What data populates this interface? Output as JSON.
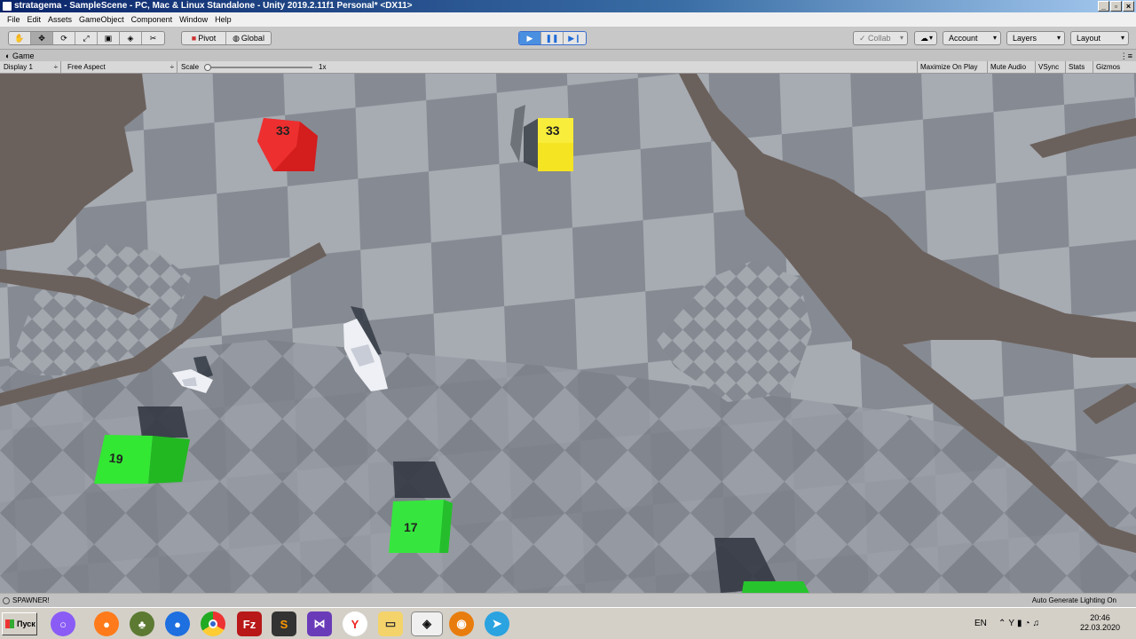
{
  "window": {
    "title": "stratagema - SampleScene - PC, Mac & Linux Standalone - Unity 2019.2.11f1 Personal* <DX11>"
  },
  "menu": [
    "File",
    "Edit",
    "Assets",
    "GameObject",
    "Component",
    "Window",
    "Help"
  ],
  "toolbar": {
    "tools": [
      "hand-tool-icon",
      "move-tool-icon",
      "rotate-tool-icon",
      "scale-tool-icon",
      "rect-tool-icon",
      "transform-tool-icon",
      "custom-tool-icon"
    ],
    "pivot": "Pivot",
    "global": "Global",
    "collab": "Collab",
    "account": "Account",
    "layers": "Layers",
    "layout": "Layout"
  },
  "game_tab": {
    "label": "Game"
  },
  "game_bar": {
    "display": "Display 1",
    "aspect": "Free Aspect",
    "scale_label": "Scale",
    "scale_value": "1x",
    "maximize": "Maximize On Play",
    "mute": "Mute Audio",
    "vsync": "VSync",
    "stats": "Stats",
    "gizmos": "Gizmos"
  },
  "scene": {
    "cubes": [
      {
        "label": "33",
        "color": "#e82424"
      },
      {
        "label": "33",
        "color": "#f2e21e"
      },
      {
        "label": "19",
        "color": "#2adf2a"
      },
      {
        "label": "17",
        "color": "#2ee83a"
      }
    ]
  },
  "status": {
    "message": "SPAWNER!",
    "right": "Auto Generate Lighting On"
  },
  "taskbar": {
    "start": "Пуск",
    "apps": [
      "alice-icon",
      "firefox-icon",
      "tree-icon",
      "firefox-dev-icon",
      "chrome-icon",
      "filezilla-icon",
      "sublime-icon",
      "visual-studio-icon",
      "yandex-icon",
      "explorer-icon",
      "unity-icon",
      "blender-icon",
      "telegram-icon"
    ],
    "lang": "EN",
    "time": "20:46",
    "date": "22.03.2020"
  }
}
